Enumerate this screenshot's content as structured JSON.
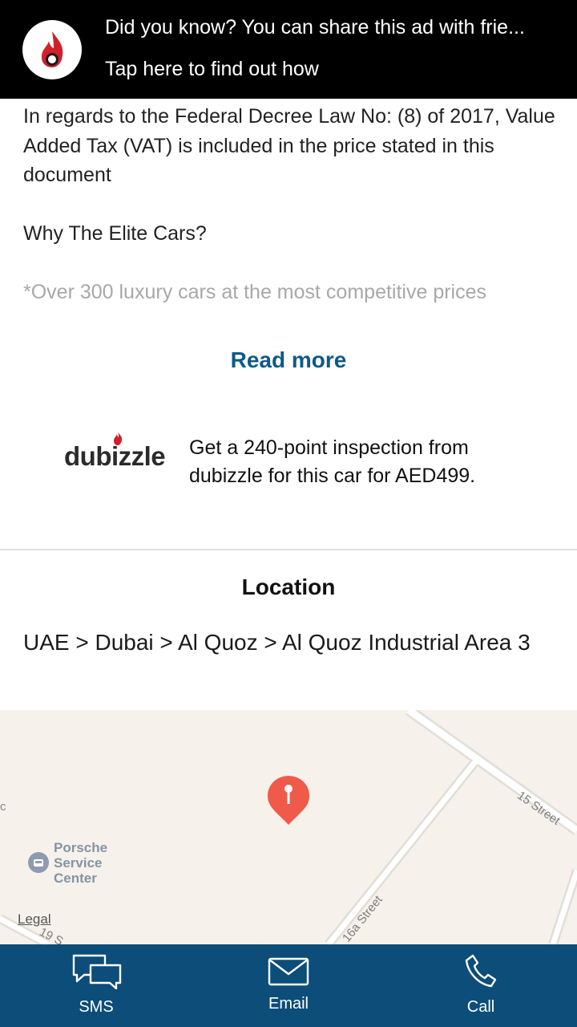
{
  "banner": {
    "line1": "Did you know? You can share this ad with frie...",
    "line2": "Tap here to find out how"
  },
  "description": {
    "para1": "In regards to the Federal Decree Law No: (8) of 2017, Value Added Tax (VAT) is included in the price stated in this document",
    "para2": "Why The Elite Cars?",
    "para3": "*Over 300 luxury cars at the most competitive prices"
  },
  "read_more": "Read more",
  "inspection": {
    "brand": "dubizzle",
    "text": "Get a 240-point inspection from dubizzle for this car for AED499."
  },
  "location": {
    "title": "Location",
    "path": "UAE > Dubai > Al Quoz > Al Quoz Industrial Area 3"
  },
  "map": {
    "poi_label": "Porsche Service Center",
    "street_15": "15 Street",
    "street_16a": "16a Street",
    "street_19": "19 S",
    "edge_char": "c",
    "legal": "Legal"
  },
  "actions": {
    "sms": "SMS",
    "email": "Email",
    "call": "Call"
  },
  "colors": {
    "brand_blue": "#0c4d7a",
    "link_blue": "#0d5a87",
    "pin_red": "#ef5a4a",
    "banner_bg": "#000000"
  },
  "icons": {
    "banner_logo": "flame-logo-icon",
    "map_pin": "map-pin-icon",
    "poi": "car-service-icon",
    "sms": "chat-bubbles-icon",
    "email": "envelope-icon",
    "call": "phone-icon"
  }
}
